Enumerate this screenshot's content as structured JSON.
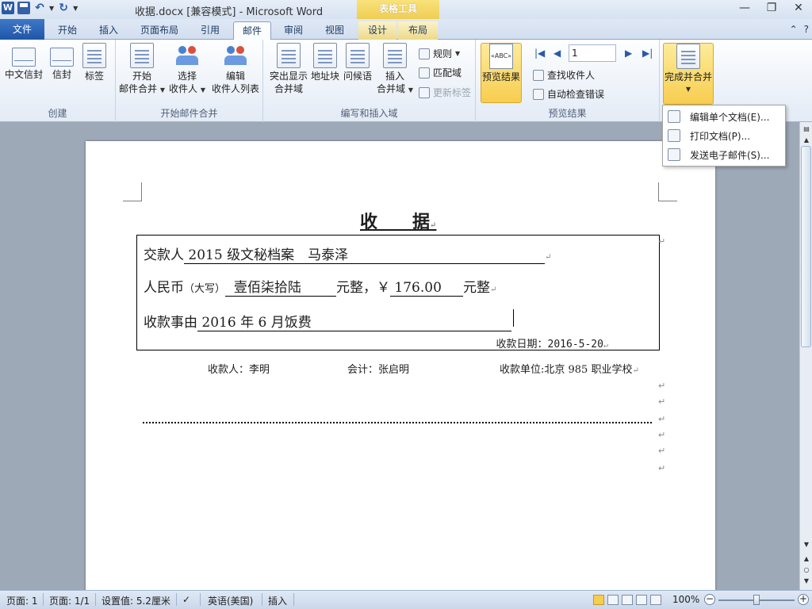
{
  "window": {
    "title": "收据.docx [兼容模式] - Microsoft Word",
    "context_tab_group": "表格工具"
  },
  "tabs": {
    "file": "文件",
    "items": [
      "开始",
      "插入",
      "页面布局",
      "引用",
      "邮件",
      "审阅",
      "视图",
      "设计",
      "布局"
    ],
    "active": "邮件"
  },
  "ribbon": {
    "create": {
      "label": "创建",
      "chinese_envelope": "中文信封",
      "envelope": "信封",
      "labels": "标签"
    },
    "start_merge": {
      "label": "开始邮件合并",
      "start_line1": "开始",
      "start_line2": "邮件合并",
      "select_line1": "选择",
      "select_line2": "收件人",
      "edit_line1": "编辑",
      "edit_line2": "收件人列表"
    },
    "write_insert": {
      "label": "编写和插入域",
      "highlight_line1": "突出显示",
      "highlight_line2": "合并域",
      "address_block": "地址块",
      "greeting": "问候语",
      "insert_line1": "插入",
      "insert_line2": "合并域",
      "rules": "规则",
      "match_fields": "匹配域",
      "update_labels": "更新标签"
    },
    "preview": {
      "label": "预览结果",
      "preview_button": "预览结果",
      "record": "1",
      "find_recipient": "查找收件人",
      "auto_check": "自动检查错误"
    },
    "finish": {
      "label": "完成并合并"
    }
  },
  "dropdown": {
    "items": [
      "编辑单个文档(E)...",
      "打印文档(P)...",
      "发送电子邮件(S)..."
    ]
  },
  "document": {
    "title": "收　　据",
    "payer_label": "交款人",
    "payer_value": "2015 级文秘档案　马泰泽",
    "rmb_label": "人民币",
    "rmb_paren": "（大写）",
    "rmb_value": "壹佰柒拾陆",
    "rmb_suffix": "元整，￥",
    "amount_value": "176.00",
    "amount_suffix": "元整",
    "reason_label": "收款事由",
    "reason_value": "2016 年 6 月饭费",
    "date": "收款日期：2016-5-20",
    "receiver": "收款人：李明",
    "accountant": "会计：张启明",
    "unit": "收款单位:北京 985 职业学校"
  },
  "status": {
    "page": "页面: 1",
    "pages": "页面: 1/1",
    "setting": "设置值: 5.2厘米",
    "language": "英语(美国)",
    "mode": "插入",
    "zoom": "100%"
  },
  "zoom_percent": 100
}
